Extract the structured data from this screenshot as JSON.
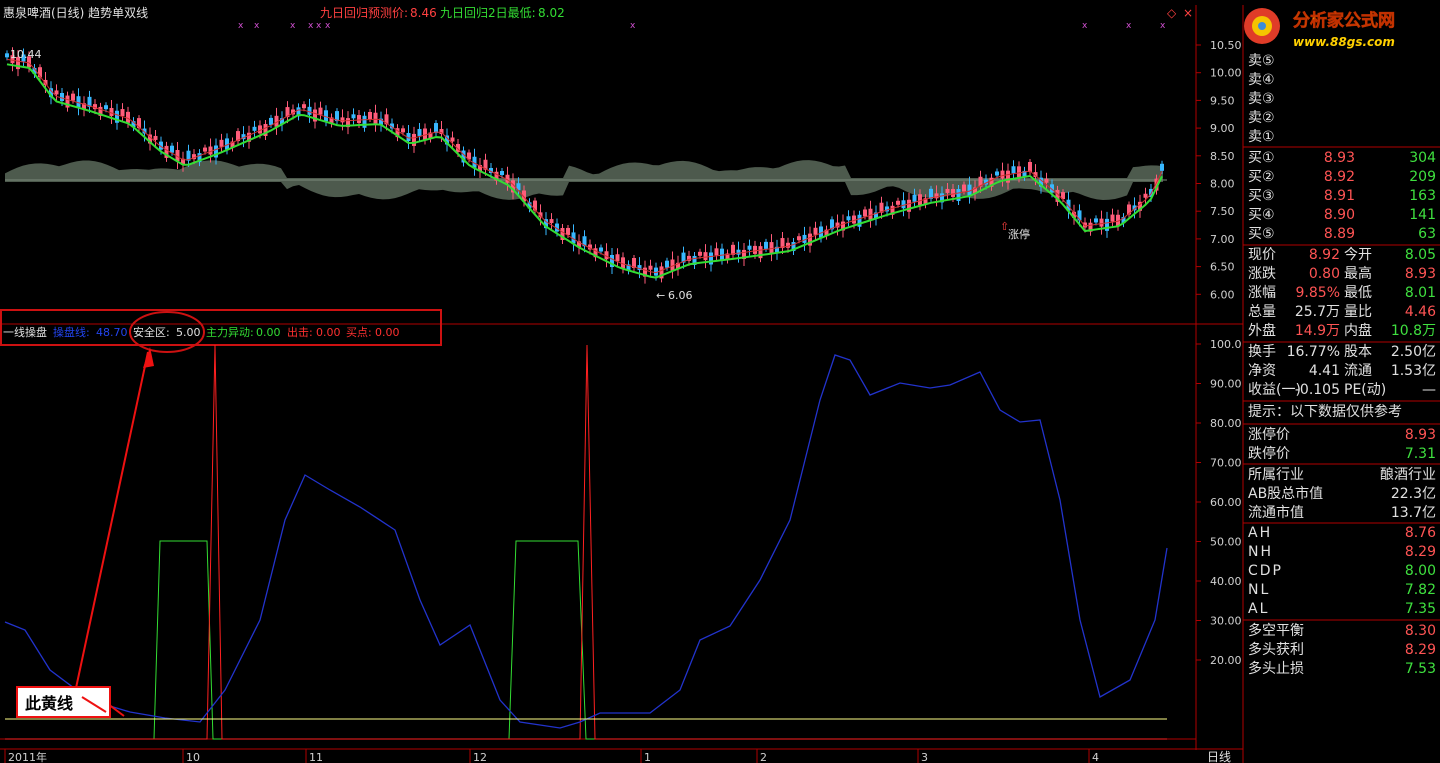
{
  "header": {
    "title": "惠泉啤酒(日线) 趋势单双线",
    "predict_label": "九日回归预测价:",
    "predict_value": "8.46",
    "low_label": "九日回归2日最低:",
    "low_value": "8.02"
  },
  "brand": {
    "name": "分析家公式网",
    "url": "www.88gs.com"
  },
  "price_axis": [
    "10.50",
    "10.00",
    "9.50",
    "9.00",
    "8.50",
    "8.00",
    "7.50",
    "7.00",
    "6.50",
    "6.00"
  ],
  "price_annotations": {
    "high": "10.44",
    "low": "6.06",
    "limit_up": "涨停"
  },
  "indicator": {
    "name": "一线操盘",
    "line_label": "操盘线:",
    "line_value": "48.70",
    "safe_label": "安全区:",
    "safe_value": "5.00",
    "main_label": "主力异动:",
    "main_value": "0.00",
    "exit_label": "出击:",
    "exit_value": "0.00",
    "buy_label": "买点:",
    "buy_value": "0.00"
  },
  "indicator_axis": [
    "100.0",
    "90.00",
    "80.00",
    "70.00",
    "60.00",
    "50.00",
    "40.00",
    "30.00",
    "20.00"
  ],
  "callout": {
    "text": "此黄线"
  },
  "time_axis": [
    "2011年",
    "10",
    "11",
    "12",
    "1",
    "2",
    "3",
    "4"
  ],
  "period_label": "日线",
  "order_book": {
    "sells": [
      {
        "label": "卖⑤",
        "price": "",
        "vol": ""
      },
      {
        "label": "卖④",
        "price": "",
        "vol": ""
      },
      {
        "label": "卖③",
        "price": "",
        "vol": ""
      },
      {
        "label": "卖②",
        "price": "",
        "vol": ""
      },
      {
        "label": "卖①",
        "price": "",
        "vol": ""
      }
    ],
    "buys": [
      {
        "label": "买①",
        "price": "8.93",
        "vol": "304"
      },
      {
        "label": "买②",
        "price": "8.92",
        "vol": "209"
      },
      {
        "label": "买③",
        "price": "8.91",
        "vol": "163"
      },
      {
        "label": "买④",
        "price": "8.90",
        "vol": "141"
      },
      {
        "label": "买⑤",
        "price": "8.89",
        "vol": "63"
      }
    ]
  },
  "quote_stats": [
    {
      "l1": "现价",
      "v1": "8.92",
      "l2": "今开",
      "v2": "8.05",
      "c1": "red",
      "c2": "green"
    },
    {
      "l1": "涨跌",
      "v1": "0.80",
      "l2": "最高",
      "v2": "8.93",
      "c1": "red",
      "c2": "red"
    },
    {
      "l1": "涨幅",
      "v1": "9.85%",
      "l2": "最低",
      "v2": "8.01",
      "c1": "red",
      "c2": "green"
    },
    {
      "l1": "总量",
      "v1": "25.7万",
      "l2": "量比",
      "v2": "4.46",
      "c1": "white",
      "c2": "red"
    },
    {
      "l1": "外盘",
      "v1": "14.9万",
      "l2": "内盘",
      "v2": "10.8万",
      "c1": "red",
      "c2": "green"
    }
  ],
  "fund_stats": [
    {
      "l1": "换手",
      "v1": "16.77%",
      "l2": "股本",
      "v2": "2.50亿"
    },
    {
      "l1": "净资",
      "v1": "4.41",
      "l2": "流通",
      "v2": "1.53亿"
    },
    {
      "l1": "收益(一)",
      "v1": "-0.105",
      "l2": "PE(动)",
      "v2": "—"
    }
  ],
  "hint": "提示：以下数据仅供参考",
  "limits": [
    {
      "label": "涨停价",
      "value": "8.93",
      "color": "red"
    },
    {
      "label": "跌停价",
      "value": "7.31",
      "color": "green"
    }
  ],
  "industry": {
    "label": "所属行业",
    "value": "酿酒行业"
  },
  "market_caps": [
    {
      "label": "AB股总市值",
      "value": "22.3亿"
    },
    {
      "label": "流通市值",
      "value": "13.7亿"
    }
  ],
  "levels": [
    {
      "label": "AH",
      "value": "8.76",
      "color": "red"
    },
    {
      "label": "NH",
      "value": "8.29",
      "color": "red"
    },
    {
      "label": "CDP",
      "value": "8.00",
      "color": "green"
    },
    {
      "label": "NL",
      "value": "7.82",
      "color": "green"
    },
    {
      "label": "AL",
      "value": "7.35",
      "color": "green"
    }
  ],
  "balance": [
    {
      "label": "多空平衡",
      "value": "8.30",
      "color": "red"
    },
    {
      "label": "多头获利",
      "value": "8.29",
      "color": "red"
    },
    {
      "label": "多头止损",
      "value": "7.53",
      "color": "green"
    }
  ],
  "colors": {
    "up": "#ff5c7a",
    "down": "#38b8ff",
    "ma": "#33dd33",
    "grid": "#b00000",
    "indicator_line": "#2233cc",
    "yellow_line": "#ffff88"
  }
}
